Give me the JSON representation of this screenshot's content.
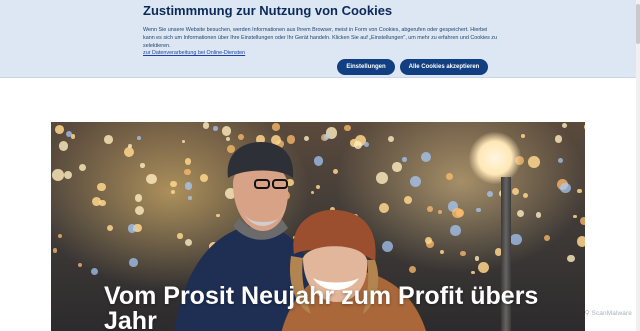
{
  "cookie_banner": {
    "title": "Zustimmmung zur Nutzung von Cookies",
    "text": "Wenn Sie unsere Website besuchen, werden Informationen aus Ihrem Browser, meist in Form von Cookies, abgerufen oder gespeichert. Hierbei kann es sich um Informationen über Ihre Einstellungen oder Ihr Gerät handeln. Klicken Sie auf „Einstellungen\", um mehr zu erfahren und Cookies zu selektieren.",
    "link": "zur Datenverarbeitung bei Online-Diensten",
    "settings_button": "Einstellungen",
    "accept_button": "Alle Cookies akzeptieren"
  },
  "hero": {
    "title": "Vom Prosit Neujahr zum Profit übers Jahr"
  },
  "watermark": "⚲ ScanMalware",
  "colors": {
    "banner_bg": "#dde7f3",
    "title": "#0b2a59",
    "button": "#123f82"
  }
}
